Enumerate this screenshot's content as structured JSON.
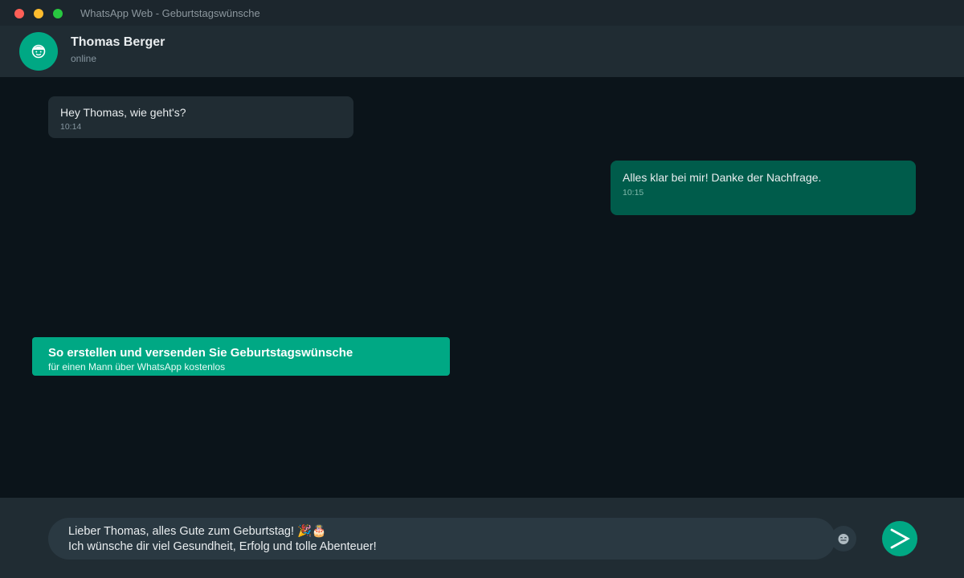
{
  "window": {
    "title": "WhatsApp Web - Geburtstagswünsche"
  },
  "header": {
    "contact_name": "Thomas Berger",
    "status": "online"
  },
  "messages": [
    {
      "direction": "incoming",
      "text": "Hey Thomas, wie geht's?",
      "time": "10:14"
    },
    {
      "direction": "outgoing",
      "text": "Alles klar bei mir! Danke der Nachfrage.",
      "time": "10:15"
    }
  ],
  "banner": {
    "title": "So erstellen und versenden Sie Geburtstagswünsche",
    "subtitle": "für einen Mann über WhatsApp kostenlos"
  },
  "composer": {
    "lines": [
      "Lieber Thomas, alles Gute zum Geburtstag! 🎉🎂",
      "Ich wünsche dir viel Gesundheit, Erfolg und tolle Abenteuer!"
    ],
    "emoji_icon": "emoji-icon",
    "send_icon": "send-icon"
  },
  "colors": {
    "accent": "#00a884",
    "outgoing_bubble": "#005c4b",
    "incoming_bubble": "#202c33",
    "background": "#0b141a"
  }
}
